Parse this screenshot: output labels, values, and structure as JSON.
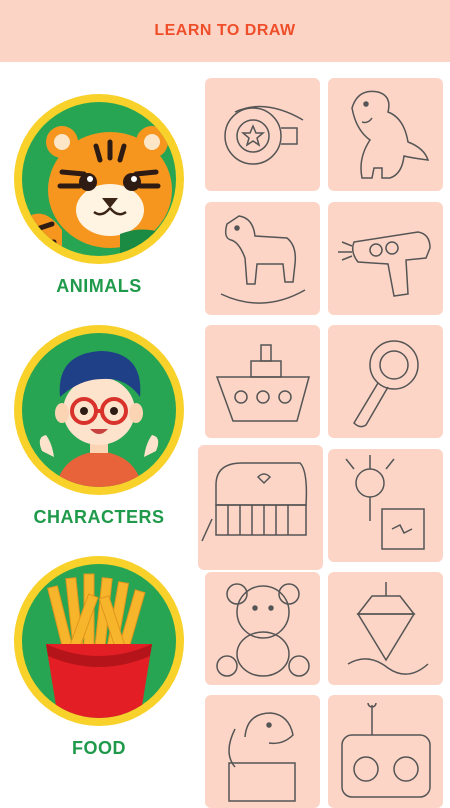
{
  "header": {
    "title": "LEARN TO DRAW"
  },
  "categories": [
    {
      "label": "ANIMALS",
      "icon": "tiger-icon"
    },
    {
      "label": "CHARACTERS",
      "icon": "boy-icon"
    },
    {
      "label": "FOOD",
      "icon": "fries-icon"
    }
  ],
  "drawings": [
    "whistle",
    "dinosaur",
    "rocking-horse",
    "water-gun",
    "boat",
    "rattle",
    "toy-piano",
    "jack-in-the-box",
    "teddy-bear",
    "spinning-top",
    "toy-dog",
    "remote-control"
  ],
  "colors": {
    "header_bg": "#fcd4c6",
    "title": "#ef4e2a",
    "card_bg": "#fcd5c7",
    "ring": "#f8d12a",
    "circle_bg": "#27a553",
    "label": "#1f9a4b"
  }
}
